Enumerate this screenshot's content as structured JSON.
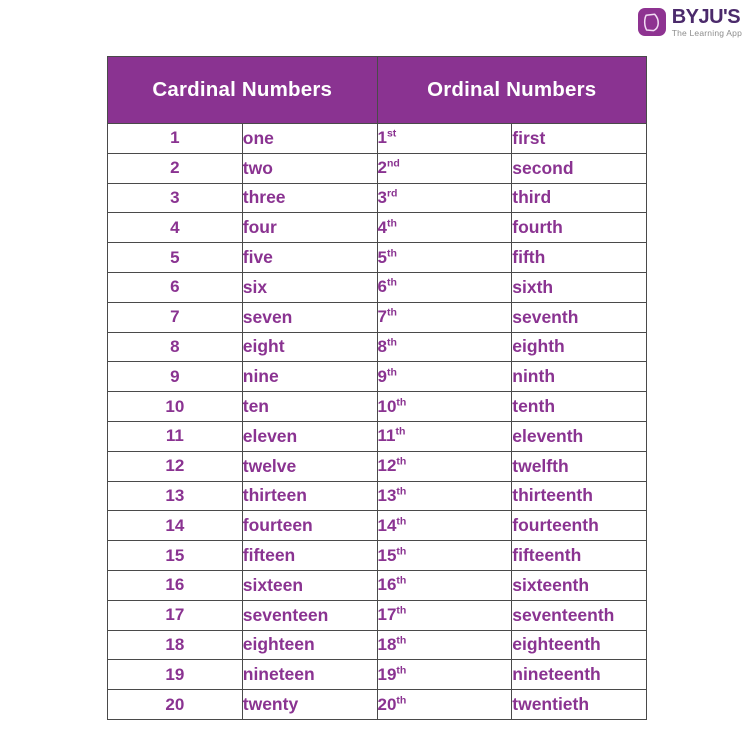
{
  "logo": {
    "name": "BYJU'S",
    "tagline": "The Learning App",
    "mark_icon": "byjus-book-icon",
    "brand_purple": "#8A3391",
    "wordmark_color": "#4B2A6B"
  },
  "table": {
    "headers": {
      "cardinal": "Cardinal Numbers",
      "ordinal": "Ordinal Numbers"
    },
    "header_bg": "#8A3391",
    "header_text_color": "#FFFFFF",
    "body_text_color": "#8A3391",
    "border_color": "#4A4A4A",
    "rows": [
      {
        "cardinal_number": "1",
        "cardinal_word": "one",
        "ordinal_number": "1",
        "ordinal_suffix": "st",
        "ordinal_word": "first"
      },
      {
        "cardinal_number": "2",
        "cardinal_word": "two",
        "ordinal_number": "2",
        "ordinal_suffix": "nd",
        "ordinal_word": "second"
      },
      {
        "cardinal_number": "3",
        "cardinal_word": "three",
        "ordinal_number": "3",
        "ordinal_suffix": "rd",
        "ordinal_word": "third"
      },
      {
        "cardinal_number": "4",
        "cardinal_word": "four",
        "ordinal_number": "4",
        "ordinal_suffix": "th",
        "ordinal_word": "fourth"
      },
      {
        "cardinal_number": "5",
        "cardinal_word": "five",
        "ordinal_number": "5",
        "ordinal_suffix": "th",
        "ordinal_word": "fifth"
      },
      {
        "cardinal_number": "6",
        "cardinal_word": "six",
        "ordinal_number": "6",
        "ordinal_suffix": "th",
        "ordinal_word": "sixth"
      },
      {
        "cardinal_number": "7",
        "cardinal_word": "seven",
        "ordinal_number": "7",
        "ordinal_suffix": "th",
        "ordinal_word": "seventh"
      },
      {
        "cardinal_number": "8",
        "cardinal_word": "eight",
        "ordinal_number": "8",
        "ordinal_suffix": "th",
        "ordinal_word": "eighth"
      },
      {
        "cardinal_number": "9",
        "cardinal_word": "nine",
        "ordinal_number": "9",
        "ordinal_suffix": "th",
        "ordinal_word": "ninth"
      },
      {
        "cardinal_number": "10",
        "cardinal_word": "ten",
        "ordinal_number": "10",
        "ordinal_suffix": "th",
        "ordinal_word": "tenth"
      },
      {
        "cardinal_number": "11",
        "cardinal_word": "eleven",
        "ordinal_number": "11",
        "ordinal_suffix": "th",
        "ordinal_word": "eleventh"
      },
      {
        "cardinal_number": "12",
        "cardinal_word": "twelve",
        "ordinal_number": "12",
        "ordinal_suffix": "th",
        "ordinal_word": "twelfth"
      },
      {
        "cardinal_number": "13",
        "cardinal_word": "thirteen",
        "ordinal_number": "13",
        "ordinal_suffix": "th",
        "ordinal_word": "thirteenth"
      },
      {
        "cardinal_number": "14",
        "cardinal_word": "fourteen",
        "ordinal_number": "14",
        "ordinal_suffix": "th",
        "ordinal_word": "fourteenth"
      },
      {
        "cardinal_number": "15",
        "cardinal_word": "fifteen",
        "ordinal_number": "15",
        "ordinal_suffix": "th",
        "ordinal_word": "fifteenth"
      },
      {
        "cardinal_number": "16",
        "cardinal_word": "sixteen",
        "ordinal_number": "16",
        "ordinal_suffix": "th",
        "ordinal_word": "sixteenth"
      },
      {
        "cardinal_number": "17",
        "cardinal_word": "seventeen",
        "ordinal_number": "17",
        "ordinal_suffix": "th",
        "ordinal_word": "seventeenth"
      },
      {
        "cardinal_number": "18",
        "cardinal_word": "eighteen",
        "ordinal_number": "18",
        "ordinal_suffix": "th",
        "ordinal_word": "eighteenth"
      },
      {
        "cardinal_number": "19",
        "cardinal_word": "nineteen",
        "ordinal_number": "19",
        "ordinal_suffix": "th",
        "ordinal_word": "nineteenth"
      },
      {
        "cardinal_number": "20",
        "cardinal_word": "twenty",
        "ordinal_number": "20",
        "ordinal_suffix": "th",
        "ordinal_word": "twentieth"
      }
    ]
  }
}
